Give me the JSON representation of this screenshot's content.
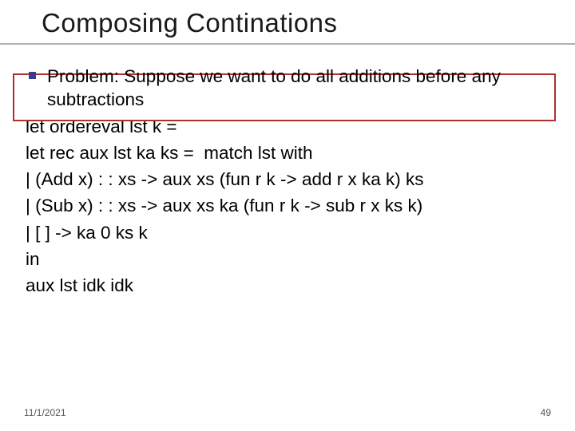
{
  "title": "Composing Continations",
  "bullet": "Problem: Suppose we want to do all additions before any subtractions",
  "code": {
    "l1": "let ordereval lst k =",
    "l2": "let rec aux lst ka ks =  match lst with",
    "l3": "| (Add x) : : xs -> aux xs (fun r k -> add r x ka k) ks",
    "l4": "| (Sub x) : : xs -> aux xs ka (fun r k -> sub r x ks k)",
    "l5": "| [ ] -> ka 0 ks k",
    "l6": "in",
    "l7": "aux lst idk idk"
  },
  "footer": {
    "date": "11/1/2021",
    "page": "49"
  }
}
